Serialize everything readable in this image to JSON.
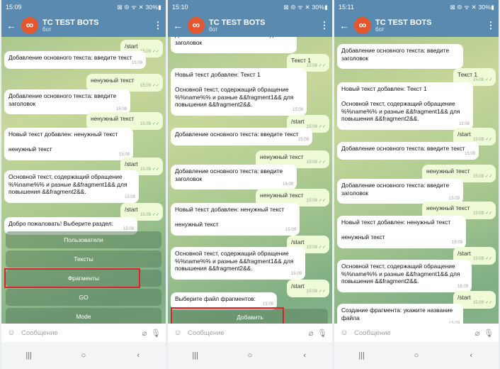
{
  "common": {
    "bot_title": "TC TEST BOTS",
    "bot_subtitle": "бот",
    "back_icon": "back-arrow-icon",
    "menu_icon": "more-vert-icon",
    "composer_placeholder": "Сообщение",
    "status_right": "⊠ ⦾ ᯤ ✕ 30%▮",
    "nav_recent": "|||",
    "nav_home": "○",
    "nav_back": "‹"
  },
  "panels": [
    {
      "time": "15:09",
      "messages": [
        {
          "dir": "out",
          "text": "/start",
          "time": "15:09"
        },
        {
          "dir": "in",
          "text": "Добавление основного текста: введите текст",
          "time": "15:09"
        },
        {
          "dir": "out",
          "text": "ненужный текст",
          "time": "15:09"
        },
        {
          "dir": "in",
          "text": "Добавление основного текста: введите\nзаголовок",
          "time": "15:09"
        },
        {
          "dir": "out",
          "text": "ненужный текст",
          "time": "15:09"
        },
        {
          "dir": "in",
          "text": "Новый текст добавлен: ненужный текст\n\nненужный текст",
          "time": "15:09"
        },
        {
          "dir": "out",
          "text": "/start",
          "time": "15:09"
        },
        {
          "dir": "in",
          "text": "Основной текст, содержащий обращение\n%%name%% и разные &&fragment1&& для\nповышения &&fragment2&&.",
          "time": "15:09"
        },
        {
          "dir": "out",
          "text": "/start",
          "time": "15:09"
        },
        {
          "dir": "in",
          "text": "Добро пожаловать! Выберите раздел:",
          "time": "15:09"
        }
      ],
      "keyboard": [
        "Пользователи",
        "Тексты",
        "Фрагменты",
        "GO",
        "Mode"
      ]
    },
    {
      "time": "15:10",
      "messages": [
        {
          "dir": "in",
          "text": "Добавление основного текста: введите\nзаголовок",
          "time": ""
        },
        {
          "dir": "out",
          "text": "Текст 1",
          "time": "15:08"
        },
        {
          "dir": "in",
          "text": "Новый текст добавлен: Текст 1\n\nОсновной текст, содержащий обращение\n%%name%% и разные &&fragment1&& для\nповышения &&fragment2&&.",
          "time": "15:08"
        },
        {
          "dir": "out",
          "text": "/start",
          "time": "15:09"
        },
        {
          "dir": "in",
          "text": "Добавление основного текста: введите текст",
          "time": "15:09"
        },
        {
          "dir": "out",
          "text": "ненужный текст",
          "time": "15:09"
        },
        {
          "dir": "in",
          "text": "Добавление основного текста: введите\nзаголовок",
          "time": "15:09"
        },
        {
          "dir": "out",
          "text": "ненужный текст",
          "time": "15:09"
        },
        {
          "dir": "in",
          "text": "Новый текст добавлен: ненужный текст\n\nненужный текст",
          "time": "15:09"
        },
        {
          "dir": "out",
          "text": "/start",
          "time": "15:09"
        },
        {
          "dir": "in",
          "text": "Основной текст, содержащий обращение\n%%name%% и разные &&fragment1&& для\nповышения &&fragment2&&.",
          "time": "15:09"
        },
        {
          "dir": "out",
          "text": "/start",
          "time": "15:09"
        },
        {
          "dir": "in",
          "text": "Выберите файл фрагментов:",
          "time": "15:09"
        }
      ],
      "keyboard": [
        "Добавить"
      ]
    },
    {
      "time": "15:11",
      "messages": [
        {
          "dir": "in",
          "text": "Добавление основного текста: введите\nзаголовок",
          "time": ""
        },
        {
          "dir": "out",
          "text": "Текст 1",
          "time": "15:08"
        },
        {
          "dir": "in",
          "text": "Новый текст добавлен: Текст 1\n\nОсновной текст, содержащий обращение\n%%name%% и разные &&fragment1&& для\nповышения &&fragment2&&.",
          "time": "15:08"
        },
        {
          "dir": "out",
          "text": "/start",
          "time": "15:09"
        },
        {
          "dir": "in",
          "text": "Добавление основного текста: введите текст",
          "time": "15:09"
        },
        {
          "dir": "out",
          "text": "ненужный текст",
          "time": "15:09"
        },
        {
          "dir": "in",
          "text": "Добавление основного текста: введите\nзаголовок",
          "time": "15:09"
        },
        {
          "dir": "out",
          "text": "ненужный текст",
          "time": "15:09"
        },
        {
          "dir": "in",
          "text": "Новый текст добавлен: ненужный текст\n\nненужный текст",
          "time": "15:09"
        },
        {
          "dir": "out",
          "text": "/start",
          "time": "15:09"
        },
        {
          "dir": "in",
          "text": "Основной текст, содержащий обращение\n%%name%% и разные &&fragment1&& для\nповышения &&fragment2&&.",
          "time": "15:09"
        },
        {
          "dir": "out",
          "text": "/start",
          "time": "15:09"
        },
        {
          "dir": "in",
          "text": "Создание фрагмента: укажите название\nфайла",
          "time": "15:09"
        }
      ],
      "keyboard": []
    }
  ]
}
